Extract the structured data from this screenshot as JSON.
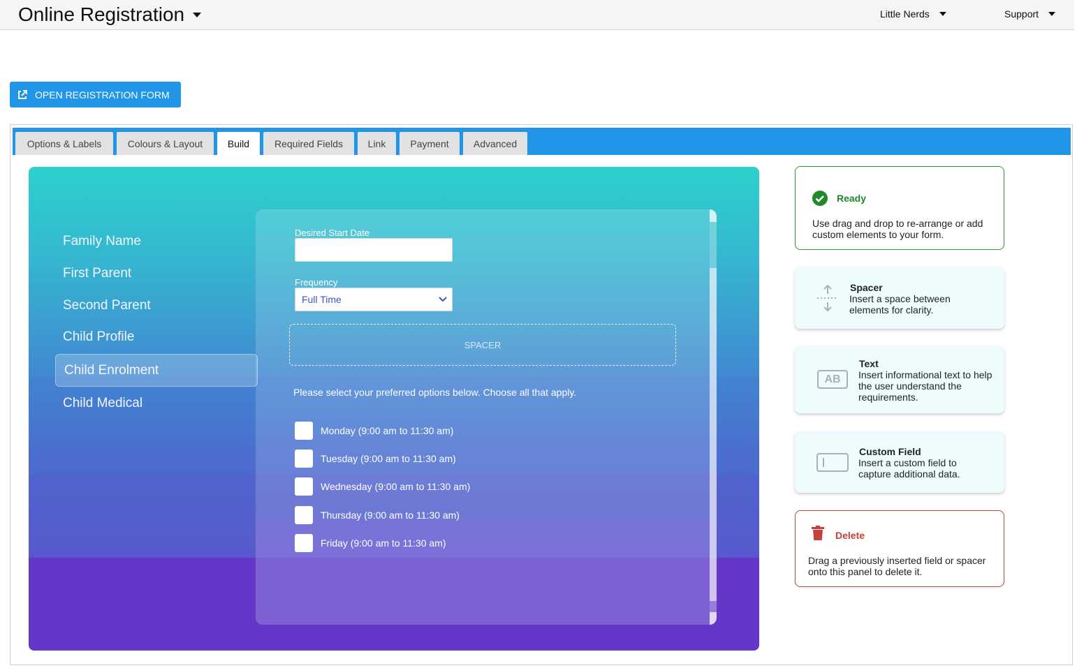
{
  "header": {
    "app_title": "Online Registration",
    "org_menu": "Little Nerds",
    "support_menu": "Support"
  },
  "toolbar": {
    "open_form_label": "OPEN REGISTRATION FORM"
  },
  "tabs": [
    {
      "label": "Options & Labels",
      "active": false
    },
    {
      "label": "Colours & Layout",
      "active": false
    },
    {
      "label": "Build",
      "active": true
    },
    {
      "label": "Required Fields",
      "active": false
    },
    {
      "label": "Link",
      "active": false
    },
    {
      "label": "Payment",
      "active": false
    },
    {
      "label": "Advanced",
      "active": false
    }
  ],
  "preview": {
    "nav": [
      {
        "label": "Family Name"
      },
      {
        "label": "First Parent"
      },
      {
        "label": "Second Parent"
      },
      {
        "label": "Child Profile"
      },
      {
        "label": "Child Enrolment",
        "selected": true
      },
      {
        "label": "Child Medical"
      }
    ],
    "form": {
      "start_date_label": "Desired Start Date",
      "start_date_value": "",
      "frequency_label": "Frequency",
      "frequency_value": "Full Time",
      "spacer_label": "SPACER",
      "instructions": "Please select your preferred options below.  Choose all that apply.",
      "options": [
        {
          "label": "Monday (9:00 am to 11:30 am)",
          "checked": false
        },
        {
          "label": "Tuesday (9:00 am to 11:30 am)",
          "checked": false
        },
        {
          "label": "Wednesday (9:00 am to 11:30 am)",
          "checked": false
        },
        {
          "label": "Thursday (9:00 am to 11:30 am)",
          "checked": false
        },
        {
          "label": "Friday (9:00 am to 11:30 am)",
          "checked": false
        }
      ]
    }
  },
  "tools": {
    "ready": {
      "title": "Ready",
      "body": "Use drag and drop to re-arrange or add custom elements to your form.",
      "color": "#1f8a2a"
    },
    "spacer": {
      "title": "Spacer",
      "body": "Insert a space between elements for clarity."
    },
    "text": {
      "title": "Text",
      "body": "Insert informational text to help the user understand the requirements.",
      "icon_text": "AB"
    },
    "custom": {
      "title": "Custom Field",
      "body": "Insert a custom field to capture additional data."
    },
    "delete": {
      "title": "Delete",
      "body": "Drag a previously inserted field or spacer onto this panel to delete it.",
      "color": "#c63f3f"
    }
  },
  "colors": {
    "accent": "#2196e8",
    "tab_bg": "#e2e2e2"
  }
}
